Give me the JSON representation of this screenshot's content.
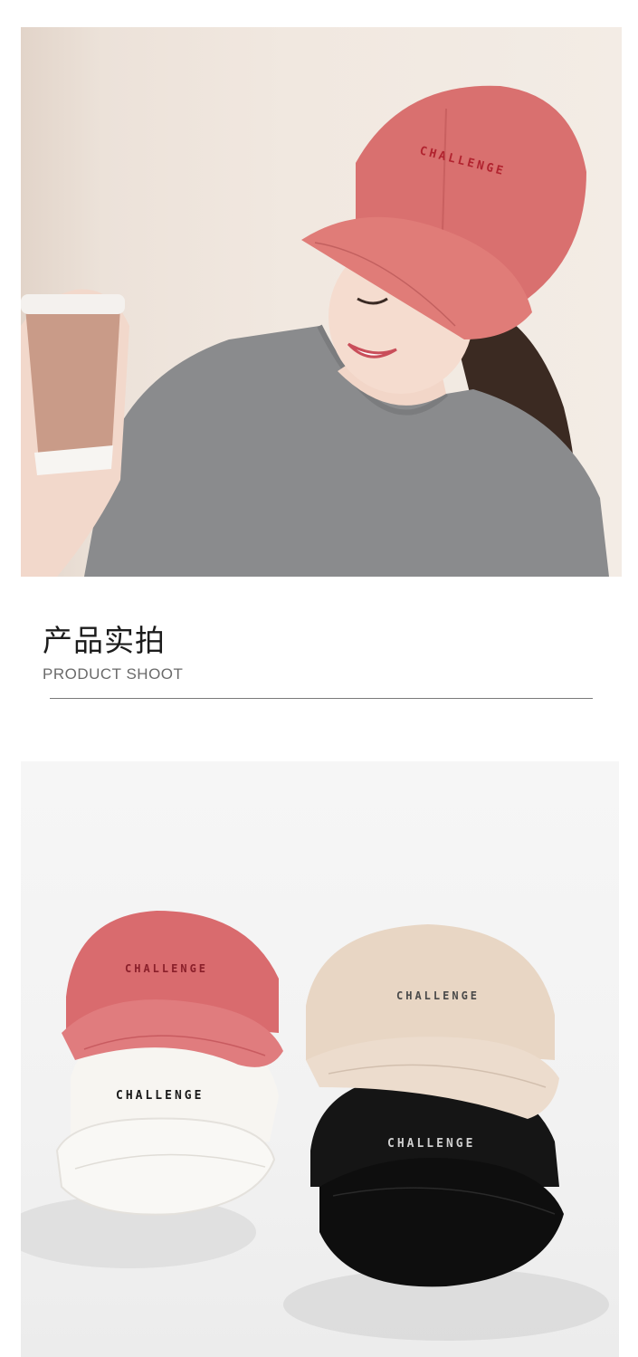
{
  "hero": {
    "cap_embroidery": "CHALLENGE"
  },
  "section": {
    "title": "产品实拍",
    "subtitle": "PRODUCT SHOOT"
  },
  "product": {
    "caps": [
      {
        "color": "pink",
        "hex": "#d96b6e",
        "text": "CHALLENGE",
        "thread": "#8a1f2a"
      },
      {
        "color": "beige",
        "hex": "#e8d6c4",
        "text": "CHALLENGE",
        "thread": "#4a4a4a"
      },
      {
        "color": "white",
        "hex": "#f7f5f1",
        "text": "CHALLENGE",
        "thread": "#1a1a1a"
      },
      {
        "color": "black",
        "hex": "#111111",
        "text": "CHALLENGE",
        "thread": "#cfcfcf"
      }
    ]
  }
}
